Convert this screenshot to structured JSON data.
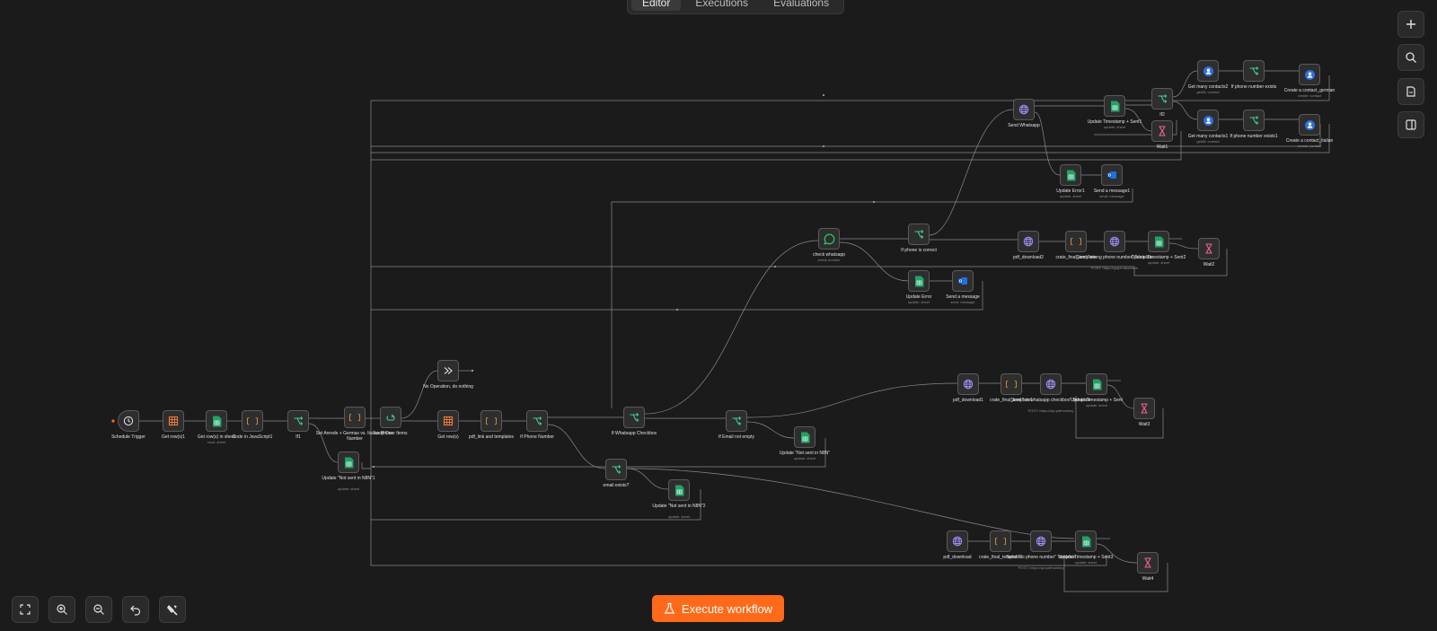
{
  "tabs": [
    {
      "label": "Editor",
      "active": true
    },
    {
      "label": "Executions",
      "active": false
    },
    {
      "label": "Evaluations",
      "active": false
    }
  ],
  "execute_button": {
    "label": "Execute workflow"
  },
  "colors": {
    "accent": "#ff6a1a",
    "canvas": "#1b1b1b",
    "node_bg": "#2e2e2e",
    "sheets_green": "#21a366",
    "code_orange": "#f0a04b",
    "http_purple": "#a78bfa",
    "if_green": "#3ecf8e",
    "wait_pink": "#f06292",
    "contact_blue": "#2f6fe0"
  },
  "nodes": {
    "schedule": {
      "label": "Schedule Trigger",
      "sub": "",
      "icon": "clock-icon"
    },
    "get_rows1": {
      "label": "Get row(s)1",
      "sub": "",
      "icon": "table-icon"
    },
    "get_rows_sheet": {
      "label": "Get row(s) in sheet",
      "sub": "read: sheet",
      "icon": "sheets-icon"
    },
    "code_js1": {
      "label": "Code in JavaScript1",
      "sub": "",
      "icon": "code-icon"
    },
    "if1": {
      "label": "If1",
      "sub": "",
      "icon": "if-icon"
    },
    "set_amode": {
      "label": "Set Anrede + Germas vs. Italian Phone Number",
      "sub": "",
      "icon": "code-icon"
    },
    "loop": {
      "label": "Loop Over Items",
      "sub": "",
      "icon": "loop-icon"
    },
    "noop": {
      "label": "No Operation, do nothing",
      "sub": "",
      "icon": "noop-icon"
    },
    "get_rows2": {
      "label": "Get row(s)",
      "sub": "",
      "icon": "table-icon"
    },
    "pdf_link": {
      "label": "pdf_link and templates",
      "sub": "",
      "icon": "code-icon"
    },
    "if_phone": {
      "label": "If Phone Number",
      "sub": "",
      "icon": "if-icon"
    },
    "if_whatsapp": {
      "label": "If Whatsapp Checkbox",
      "sub": "",
      "icon": "if-icon"
    },
    "if_email": {
      "label": "If Email not empty",
      "sub": "",
      "icon": "if-icon"
    },
    "update_not_sent_n8n": {
      "label": "Update \"Not sent in N8N\"",
      "sub": "update: sheet",
      "icon": "sheets-icon"
    },
    "update_not_sent1": {
      "label": "Update \"Not sent in N8N\"1",
      "sub": "update: sheet",
      "icon": "sheets-icon"
    },
    "email_exists": {
      "label": "email exists?",
      "sub": "",
      "icon": "if-icon"
    },
    "update_not_sent2": {
      "label": "Update \"Not sent in N8N\"2",
      "sub": "update: sheet",
      "icon": "sheets-icon"
    },
    "pdf_download1": {
      "label": "pdf_download1",
      "sub": "",
      "icon": "http-icon"
    },
    "crate_final_template1": {
      "label": "crate_final_template1",
      "sub": "",
      "icon": "code-icon"
    },
    "send_no_whatsapp": {
      "label": "Send \"no whatsapp checkbox\" Template",
      "sub": "POST: https://api.pdfmonkey",
      "icon": "http-icon"
    },
    "update_ts_sent": {
      "label": "Update Timestamp + Sent",
      "sub": "update: sheet",
      "icon": "sheets-icon"
    },
    "wait3": {
      "label": "Wait3",
      "sub": "",
      "icon": "hourglass-icon"
    },
    "check_whatsapp": {
      "label": "check whatsapp",
      "sub": "check number",
      "icon": "whatsapp-icon"
    },
    "if_phone_correct": {
      "label": "If phone is correct",
      "sub": "",
      "icon": "if-icon"
    },
    "pdf_download2": {
      "label": "pdf_download2",
      "sub": "",
      "icon": "http-icon"
    },
    "crate_final_template": {
      "label": "crate_final_template",
      "sub": "",
      "icon": "code-icon"
    },
    "send_wrong_phone": {
      "label": "Send \"wrong phone number\" Template",
      "sub": "POST: https://graph.facebook",
      "icon": "http-icon"
    },
    "update_ts_sent2": {
      "label": "Update Timestamp + Sent2",
      "sub": "update: sheet",
      "icon": "sheets-icon"
    },
    "wait2": {
      "label": "Wait2",
      "sub": "",
      "icon": "hourglass-icon"
    },
    "update_error": {
      "label": "Update Error",
      "sub": "update: sheet",
      "icon": "sheets-icon"
    },
    "send_message": {
      "label": "Send a message",
      "sub": "send: message",
      "icon": "outlook-icon"
    },
    "send_whatsapp": {
      "label": "Send Whatsapp",
      "sub": "",
      "icon": "http-icon"
    },
    "update_ts_sent1": {
      "label": "Update Timestamp + Sent1",
      "sub": "update: sheet",
      "icon": "sheets-icon"
    },
    "update_error1": {
      "label": "Update Error1",
      "sub": "update: sheet",
      "icon": "sheets-icon"
    },
    "send_message1": {
      "label": "Send a message1",
      "sub": "send: message",
      "icon": "outlook-icon"
    },
    "if2": {
      "label": "If2",
      "sub": "",
      "icon": "if-icon"
    },
    "wait1": {
      "label": "Wait1",
      "sub": "",
      "icon": "hourglass-icon"
    },
    "get_contacts2": {
      "label": "Get many contacts2",
      "sub": "getAll: contact",
      "icon": "contact-icon"
    },
    "if_phone_exists": {
      "label": "If phone number exists",
      "sub": "",
      "icon": "if-icon"
    },
    "create_contact_german": {
      "label": "Create a contact_german",
      "sub": "create: contact",
      "icon": "contact-icon"
    },
    "get_contacts1": {
      "label": "Get many contacts1",
      "sub": "getAll: contact",
      "icon": "contact-icon"
    },
    "if_phone_exists1": {
      "label": "If phone number exists1",
      "sub": "",
      "icon": "if-icon"
    },
    "create_contact_italian": {
      "label": "Create a contact_italian",
      "sub": "create: contact",
      "icon": "contact-icon"
    },
    "pdf_download": {
      "label": "pdf_download",
      "sub": "",
      "icon": "http-icon"
    },
    "crate_final_template2": {
      "label": "crate_final_template2",
      "sub": "",
      "icon": "code-icon"
    },
    "send_no_phone": {
      "label": "Send \"no phone number\" Template",
      "sub": "POST: https://api.pdfmonkey",
      "icon": "http-icon"
    },
    "update_ts_sent3": {
      "label": "Update Timestamp + Sent3",
      "sub": "update: sheet",
      "icon": "sheets-icon"
    },
    "wait4": {
      "label": "Wait4",
      "sub": "",
      "icon": "hourglass-icon"
    }
  },
  "right_toolbar": [
    "plus-icon",
    "search-icon",
    "sticky-note-icon",
    "panel-icon"
  ],
  "canvas_controls": [
    "fit-view-icon",
    "zoom-in-icon",
    "zoom-out-icon",
    "undo-icon",
    "tidy-up-icon"
  ]
}
